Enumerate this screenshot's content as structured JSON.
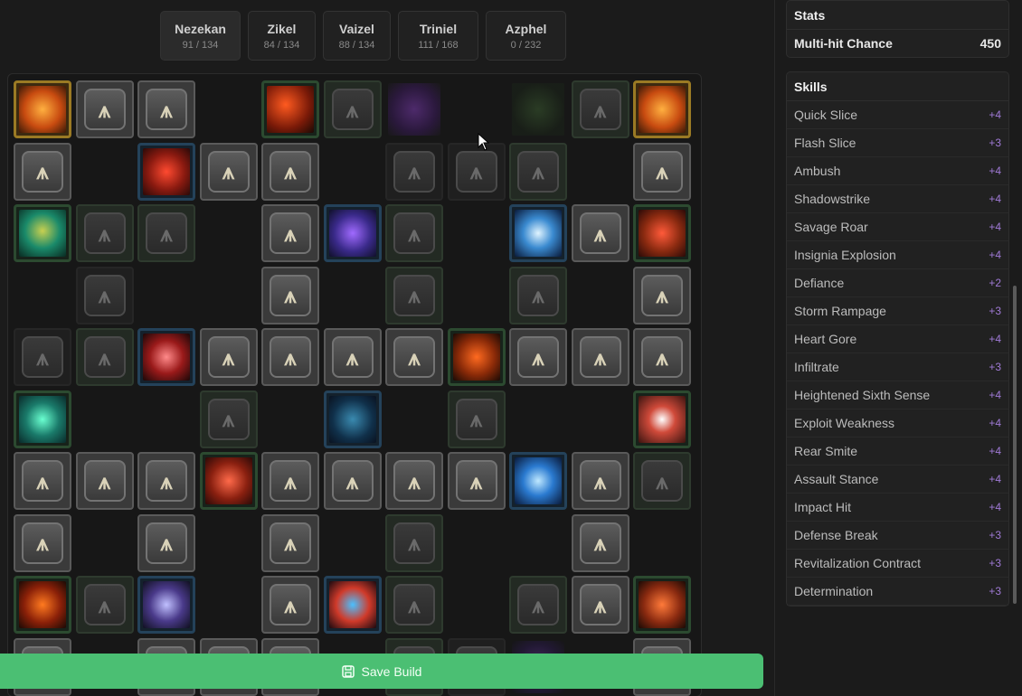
{
  "tabs": [
    {
      "name": "Nezekan",
      "count": "91 / 134"
    },
    {
      "name": "Zikel",
      "count": "84 / 134"
    },
    {
      "name": "Vaizel",
      "count": "88 / 134"
    },
    {
      "name": "Triniel",
      "count": "111 / 168"
    },
    {
      "name": "Azphel",
      "count": "0 / 232"
    }
  ],
  "stats": {
    "title": "Stats",
    "rows": [
      {
        "label": "Multi-hit Chance",
        "value": "450"
      }
    ]
  },
  "skills": {
    "title": "Skills",
    "items": [
      {
        "label": "Quick Slice",
        "value": "+4"
      },
      {
        "label": "Flash Slice",
        "value": "+3"
      },
      {
        "label": "Ambush",
        "value": "+4"
      },
      {
        "label": "Shadowstrike",
        "value": "+4"
      },
      {
        "label": "Savage Roar",
        "value": "+4"
      },
      {
        "label": "Insignia Explosion",
        "value": "+4"
      },
      {
        "label": "Defiance",
        "value": "+2"
      },
      {
        "label": "Storm Rampage",
        "value": "+3"
      },
      {
        "label": "Heart Gore",
        "value": "+4"
      },
      {
        "label": "Infiltrate",
        "value": "+3"
      },
      {
        "label": "Heightened Sixth Sense",
        "value": "+4"
      },
      {
        "label": "Exploit Weakness",
        "value": "+4"
      },
      {
        "label": "Rear Smite",
        "value": "+4"
      },
      {
        "label": "Assault Stance",
        "value": "+4"
      },
      {
        "label": "Impact Hit",
        "value": "+4"
      },
      {
        "label": "Defense Break",
        "value": "+3"
      },
      {
        "label": "Revitalization Contract",
        "value": "+3"
      },
      {
        "label": "Determination",
        "value": "+3"
      }
    ]
  },
  "save_button": {
    "label": "Save Build",
    "icon": "floppy-disk-icon"
  },
  "colors": {
    "accent": "#4bbf73",
    "skill_value": "#a07ad6"
  }
}
